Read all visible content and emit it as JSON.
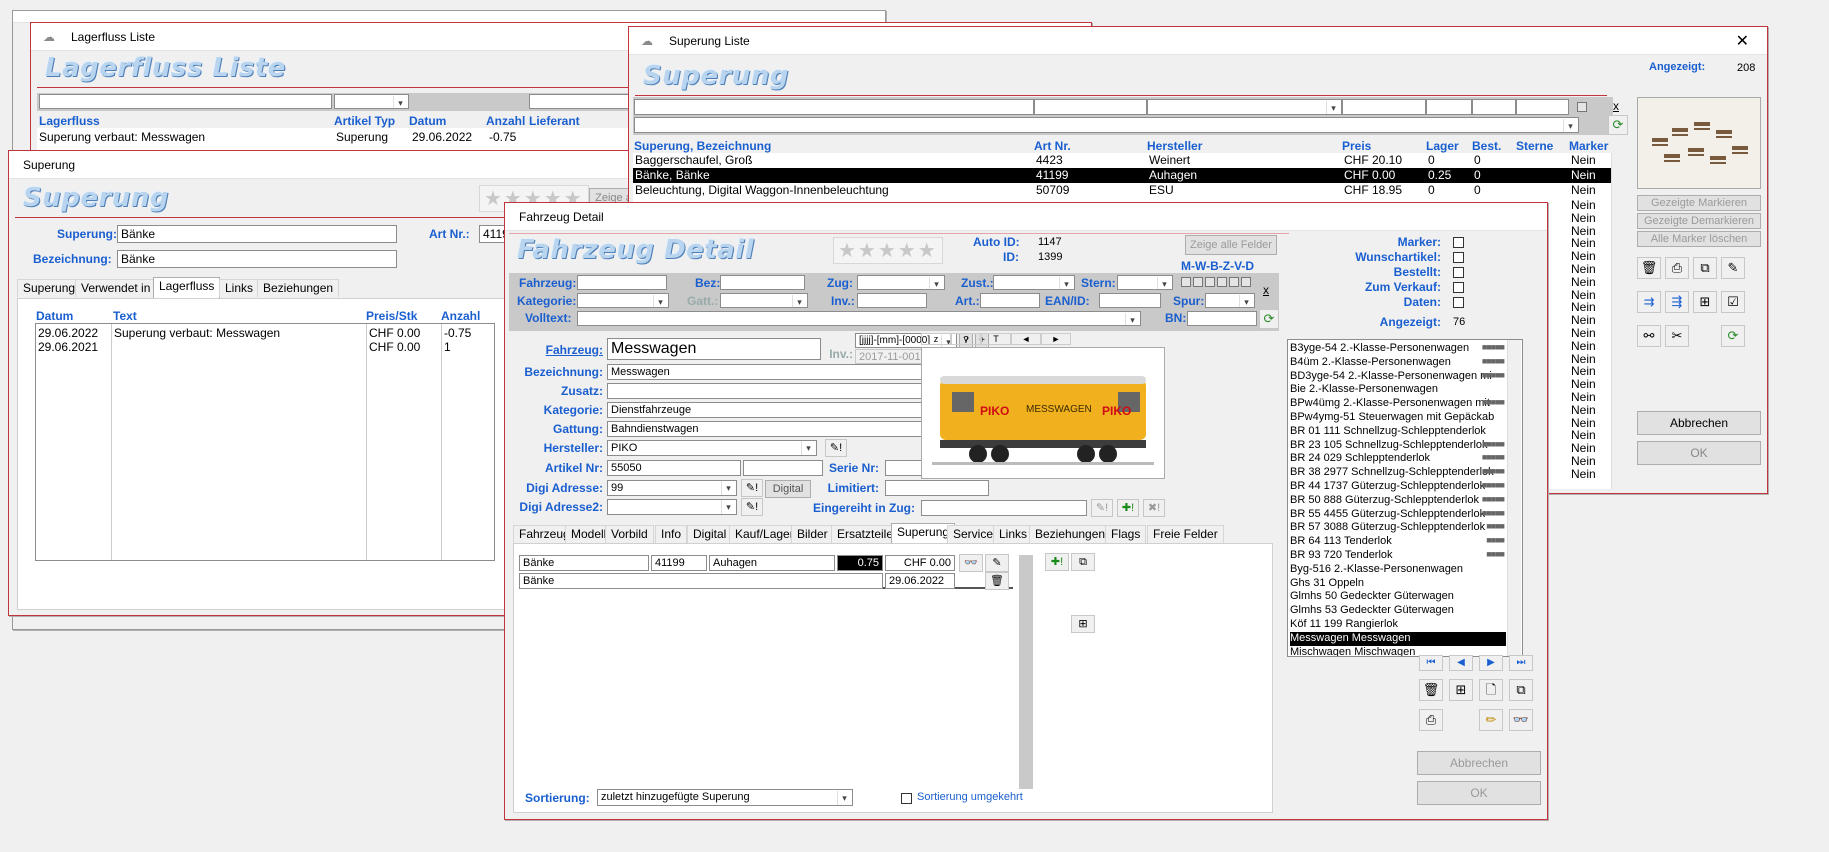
{
  "lagerfluss": {
    "window_title": "Lagerfluss Liste",
    "big_title": "Lagerfluss Liste",
    "columns": [
      "Lagerfluss",
      "Artikel Typ",
      "Datum",
      "Anzahl",
      "Lieferant"
    ],
    "rows": [
      {
        "lagerfluss": "Superung verbaut: Messwagen",
        "typ": "Superung",
        "datum": "29.06.2022",
        "anzahl": "-0.75"
      }
    ]
  },
  "superung_detail": {
    "window_title": "Superung",
    "big_title": "Superung",
    "stars": "★★★★★",
    "zeige_label": "Zeige alle",
    "superung_label": "Superung:",
    "superung_value": "Bänke",
    "bezeichnung_label": "Bezeichnung:",
    "bezeichnung_value": "Bänke",
    "artnr_label": "Art Nr.:",
    "artnr_value": "4119",
    "tabs": [
      "Superung",
      "Verwendet in",
      "Lagerfluss",
      "Links",
      "Beziehungen"
    ],
    "columns": [
      "Datum",
      "Text",
      "Preis/Stk",
      "Anzahl"
    ],
    "rows": [
      {
        "datum": "29.06.2022",
        "text": "Superung verbaut: Messwagen",
        "preis": "CHF 0.00",
        "anzahl": "-0.75"
      },
      {
        "datum": "29.06.2021",
        "text": "",
        "preis": "CHF 0.00",
        "anzahl": "1"
      }
    ]
  },
  "superung_liste": {
    "window_title": "Superung Liste",
    "big_title": "Superung",
    "angezeigt_label": "Angezeigt:",
    "angezeigt_value": "208",
    "columns": [
      "Superung, Bezeichnung",
      "Art Nr.",
      "Hersteller",
      "Preis",
      "Lager",
      "Best.",
      "Sterne",
      "Marker"
    ],
    "rows": [
      {
        "name": "Baggerschaufel, Groß",
        "artnr": "4423",
        "hersteller": "Weinert",
        "preis": "CHF 20.10",
        "lager": "0",
        "best": "0",
        "marker": "Nein"
      },
      {
        "name": "Bänke, Bänke",
        "artnr": "41199",
        "hersteller": "Auhagen",
        "preis": "CHF 0.00",
        "lager": "0.25",
        "best": "0",
        "marker": "Nein"
      },
      {
        "name": "Beleuchtung, Digital Waggon-Innenbeleuchtung",
        "artnr": "50709",
        "hersteller": "ESU",
        "preis": "CHF 18.95",
        "lager": "0",
        "best": "0",
        "marker": "Nein"
      }
    ],
    "nein_column": [
      "Nein",
      "Nein",
      "Nein",
      "Nein",
      "Nein",
      "Nein",
      "Nein",
      "Nein",
      "Nein",
      "Nein",
      "Nein",
      "Nein",
      "Nein",
      "Nein",
      "Nein",
      "Nein",
      "Nein",
      "Nein",
      "Nein",
      "Nein",
      "Nein",
      "Nein"
    ],
    "btn_gezeigte_markieren": "Gezeigte Markieren",
    "btn_gezeigte_demarkieren": "Gezeigte Demarkieren",
    "btn_alle_marker": "Alle Marker löschen",
    "btn_abbrechen": "Abbrechen",
    "btn_ok": "OK",
    "filter_x": "x"
  },
  "fahrzeug_detail": {
    "window_title": "Fahrzeug Detail",
    "big_title": "Fahrzeug Detail",
    "stars": "★★★★★",
    "auto_id_label": "Auto ID:",
    "auto_id_value": "1147",
    "id_label": "ID:",
    "id_value": "1399",
    "zeige_alle_felder": "Zeige alle Felder",
    "mwbzvd": "M-W-B-Z-V-D",
    "filter_labels": {
      "fahrzeug": "Fahrzeug:",
      "bez": "Bez:",
      "zug": "Zug:",
      "zust": "Zust.:",
      "stern": "Stern:",
      "kategorie": "Kategorie:",
      "gatt": "Gatt.:",
      "inv": "Inv.:",
      "art": "Art.:",
      "ean": "EAN/ID:",
      "spur": "Spur:",
      "volltext": "Volltext:",
      "bn": "BN:"
    },
    "marker_label": "Marker:",
    "wunschartikel_label": "Wunschartikel:",
    "bestellt_label": "Bestellt:",
    "zum_verkauf_label": "Zum Verkauf:",
    "daten_label": "Daten:",
    "angezeigt_label": "Angezeigt:",
    "angezeigt_value": "76",
    "fahrzeug_label": "Fahrzeug:",
    "fahrzeug_value": "Messwagen",
    "inv_label": "Inv.:",
    "inv_format": "[jjjj]-[mm]-[0000]",
    "inv_value": "2017-11-0010",
    "bezeichnung_label": "Bezeichnung:",
    "bezeichnung_value": "Messwagen",
    "zusatz_label": "Zusatz:",
    "zusatz_value": "",
    "kategorie_label": "Kategorie:",
    "kategorie_value": "Dienstfahrzeuge",
    "gattung_label": "Gattung:",
    "gattung_value": "Bahndienstwagen",
    "hersteller_label": "Hersteller:",
    "hersteller_value": "PIKO",
    "artikel_label": "Artikel Nr:",
    "artikel_value": "55050",
    "serie_label": "Serie Nr:",
    "digi_label": "Digi Adresse:",
    "digi_value": "99",
    "digital_btn": "Digital",
    "limitiert_label": "Limitiert:",
    "digi2_label": "Digi Adresse2:",
    "eingereiht_label": "Eingereiht in Zug:",
    "image_caption": "MESSWAGEN",
    "piko_logo": "PIKO",
    "img_tabs": [
      "z",
      "v",
      "T",
      "◄",
      "►"
    ],
    "tabs": [
      "Fahrzeug",
      "Modell",
      "Vorbild",
      "Info",
      "Digital",
      "Kauf/Lager",
      "Bilder",
      "Ersatzteile",
      "Superung",
      "Service",
      "Links",
      "Beziehungen",
      "Flags",
      "Freie Felder"
    ],
    "sup_row": {
      "name": "Bänke",
      "artnr": "41199",
      "hersteller": "Auhagen",
      "anzahl": "0.75",
      "preis": "CHF 0.00",
      "bez": "Bänke",
      "datum": "29.06.2022"
    },
    "sortierung_label": "Sortierung:",
    "sortierung_value": "zuletzt hinzugefügte Superung",
    "sortierung_umgekehrt": "Sortierung umgekehrt",
    "vehicle_list": [
      {
        "name": "B3yge-54 2.-Klasse-Personenwagen",
        "stars": "■■■■■"
      },
      {
        "name": "B4üm 2.-Klasse-Personenwagen",
        "stars": "■■■■■"
      },
      {
        "name": "BD3yge-54 2.-Klasse-Personenwagen mi",
        "stars": "■■■■■"
      },
      {
        "name": "Bie 2.-Klasse-Personenwagen",
        "stars": ""
      },
      {
        "name": "BPw4ümg 2.-Klasse-Personenwagen mit",
        "stars": "■■■■■"
      },
      {
        "name": "BPw4ymg-51 Steuerwagen mit Gepäckab",
        "stars": ""
      },
      {
        "name": "BR 01 111 Schnellzug-Schlepptenderlok",
        "stars": ""
      },
      {
        "name": "BR 23 105 Schnellzug-Schlepptenderlok",
        "stars": "■■■■■"
      },
      {
        "name": "BR 24 029 Schlepptenderlok",
        "stars": "■■■■■"
      },
      {
        "name": "BR 38 2977 Schnellzug-Schlepptenderlok",
        "stars": "■■■■■"
      },
      {
        "name": "BR 44 1737 Güterzug-Schlepptenderlok",
        "stars": "■■■■■"
      },
      {
        "name": "BR 50 888 Güterzug-Schlepptenderlok",
        "stars": "■■■■■"
      },
      {
        "name": "BR 55 4455 Güterzug-Schlepptenderlok",
        "stars": "■■■■■"
      },
      {
        "name": "BR 57 3088 Güterzug-Schlepptenderlok",
        "stars": "■■■■"
      },
      {
        "name": "BR 64 113 Tenderlok",
        "stars": "■■■■"
      },
      {
        "name": "BR 93 720 Tenderlok",
        "stars": "■■■■"
      },
      {
        "name": "Byg-516 2.-Klasse-Personenwagen",
        "stars": ""
      },
      {
        "name": "Ghs 31 Oppeln",
        "stars": ""
      },
      {
        "name": "Glmhs 50 Gedeckter Güterwagen",
        "stars": ""
      },
      {
        "name": "Glmhs 53 Gedeckter Güterwagen",
        "stars": ""
      },
      {
        "name": "Köf 11 199 Rangierlok",
        "stars": ""
      },
      {
        "name": "Messwagen Messwagen",
        "stars": ""
      },
      {
        "name": "Mischwagen Mischwagen",
        "stars": ""
      }
    ],
    "btn_abbrechen": "Abbrechen",
    "btn_ok": "OK",
    "filter_x": "x"
  }
}
